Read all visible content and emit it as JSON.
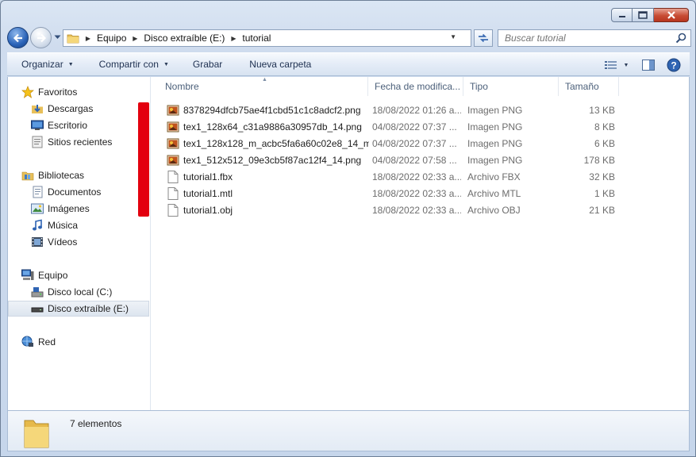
{
  "window": {
    "caption_buttons": [
      "minimize-icon",
      "maximize-icon",
      "close-icon"
    ]
  },
  "navigation": {
    "breadcrumb": [
      "Equipo",
      "Disco extraíble (E:)",
      "tutorial"
    ],
    "search_placeholder": "Buscar tutorial"
  },
  "toolbar": {
    "organize_label": "Organizar",
    "share_label": "Compartir con",
    "burn_label": "Grabar",
    "new_folder_label": "Nueva carpeta"
  },
  "sidebar": {
    "favorites_label": "Favoritos",
    "favorites": [
      "Descargas",
      "Escritorio",
      "Sitios recientes"
    ],
    "libraries_label": "Bibliotecas",
    "libraries": [
      "Documentos",
      "Imágenes",
      "Música",
      "Vídeos"
    ],
    "computer_label": "Equipo",
    "drives": [
      "Disco local (C:)",
      "Disco extraíble (E:)"
    ],
    "selected_drive": "Disco extraíble (E:)",
    "network_label": "Red"
  },
  "columns": {
    "name": "Nombre",
    "date": "Fecha de modifica...",
    "type": "Tipo",
    "size": "Tamaño"
  },
  "files": [
    {
      "name": "8378294dfcb75ae4f1cbd51c1c8adcf2.png",
      "date": "18/08/2022 01:26 a...",
      "type": "Imagen PNG",
      "size": "13 KB",
      "icon": "png-image-icon"
    },
    {
      "name": "tex1_128x64_c31a9886a30957db_14.png",
      "date": "04/08/2022 07:37 ...",
      "type": "Imagen PNG",
      "size": "8 KB",
      "icon": "png-image-icon"
    },
    {
      "name": "tex1_128x128_m_acbc5fa6a60c02e8_14_m...",
      "date": "04/08/2022 07:37 ...",
      "type": "Imagen PNG",
      "size": "6 KB",
      "icon": "png-image-icon"
    },
    {
      "name": "tex1_512x512_09e3cb5f87ac12f4_14.png",
      "date": "04/08/2022 07:58 ...",
      "type": "Imagen PNG",
      "size": "178 KB",
      "icon": "png-image-icon"
    },
    {
      "name": "tutorial1.fbx",
      "date": "18/08/2022 02:33 a...",
      "type": "Archivo FBX",
      "size": "32 KB",
      "icon": "blank-file-icon"
    },
    {
      "name": "tutorial1.mtl",
      "date": "18/08/2022 02:33 a...",
      "type": "Archivo MTL",
      "size": "1 KB",
      "icon": "blank-file-icon"
    },
    {
      "name": "tutorial1.obj",
      "date": "18/08/2022 02:33 a...",
      "type": "Archivo OBJ",
      "size": "21 KB",
      "icon": "blank-file-icon"
    }
  ],
  "status": {
    "item_count": "7 elementos"
  },
  "colors": {
    "highlight_marker": "#e3000f",
    "selection": "#dde5ef"
  }
}
